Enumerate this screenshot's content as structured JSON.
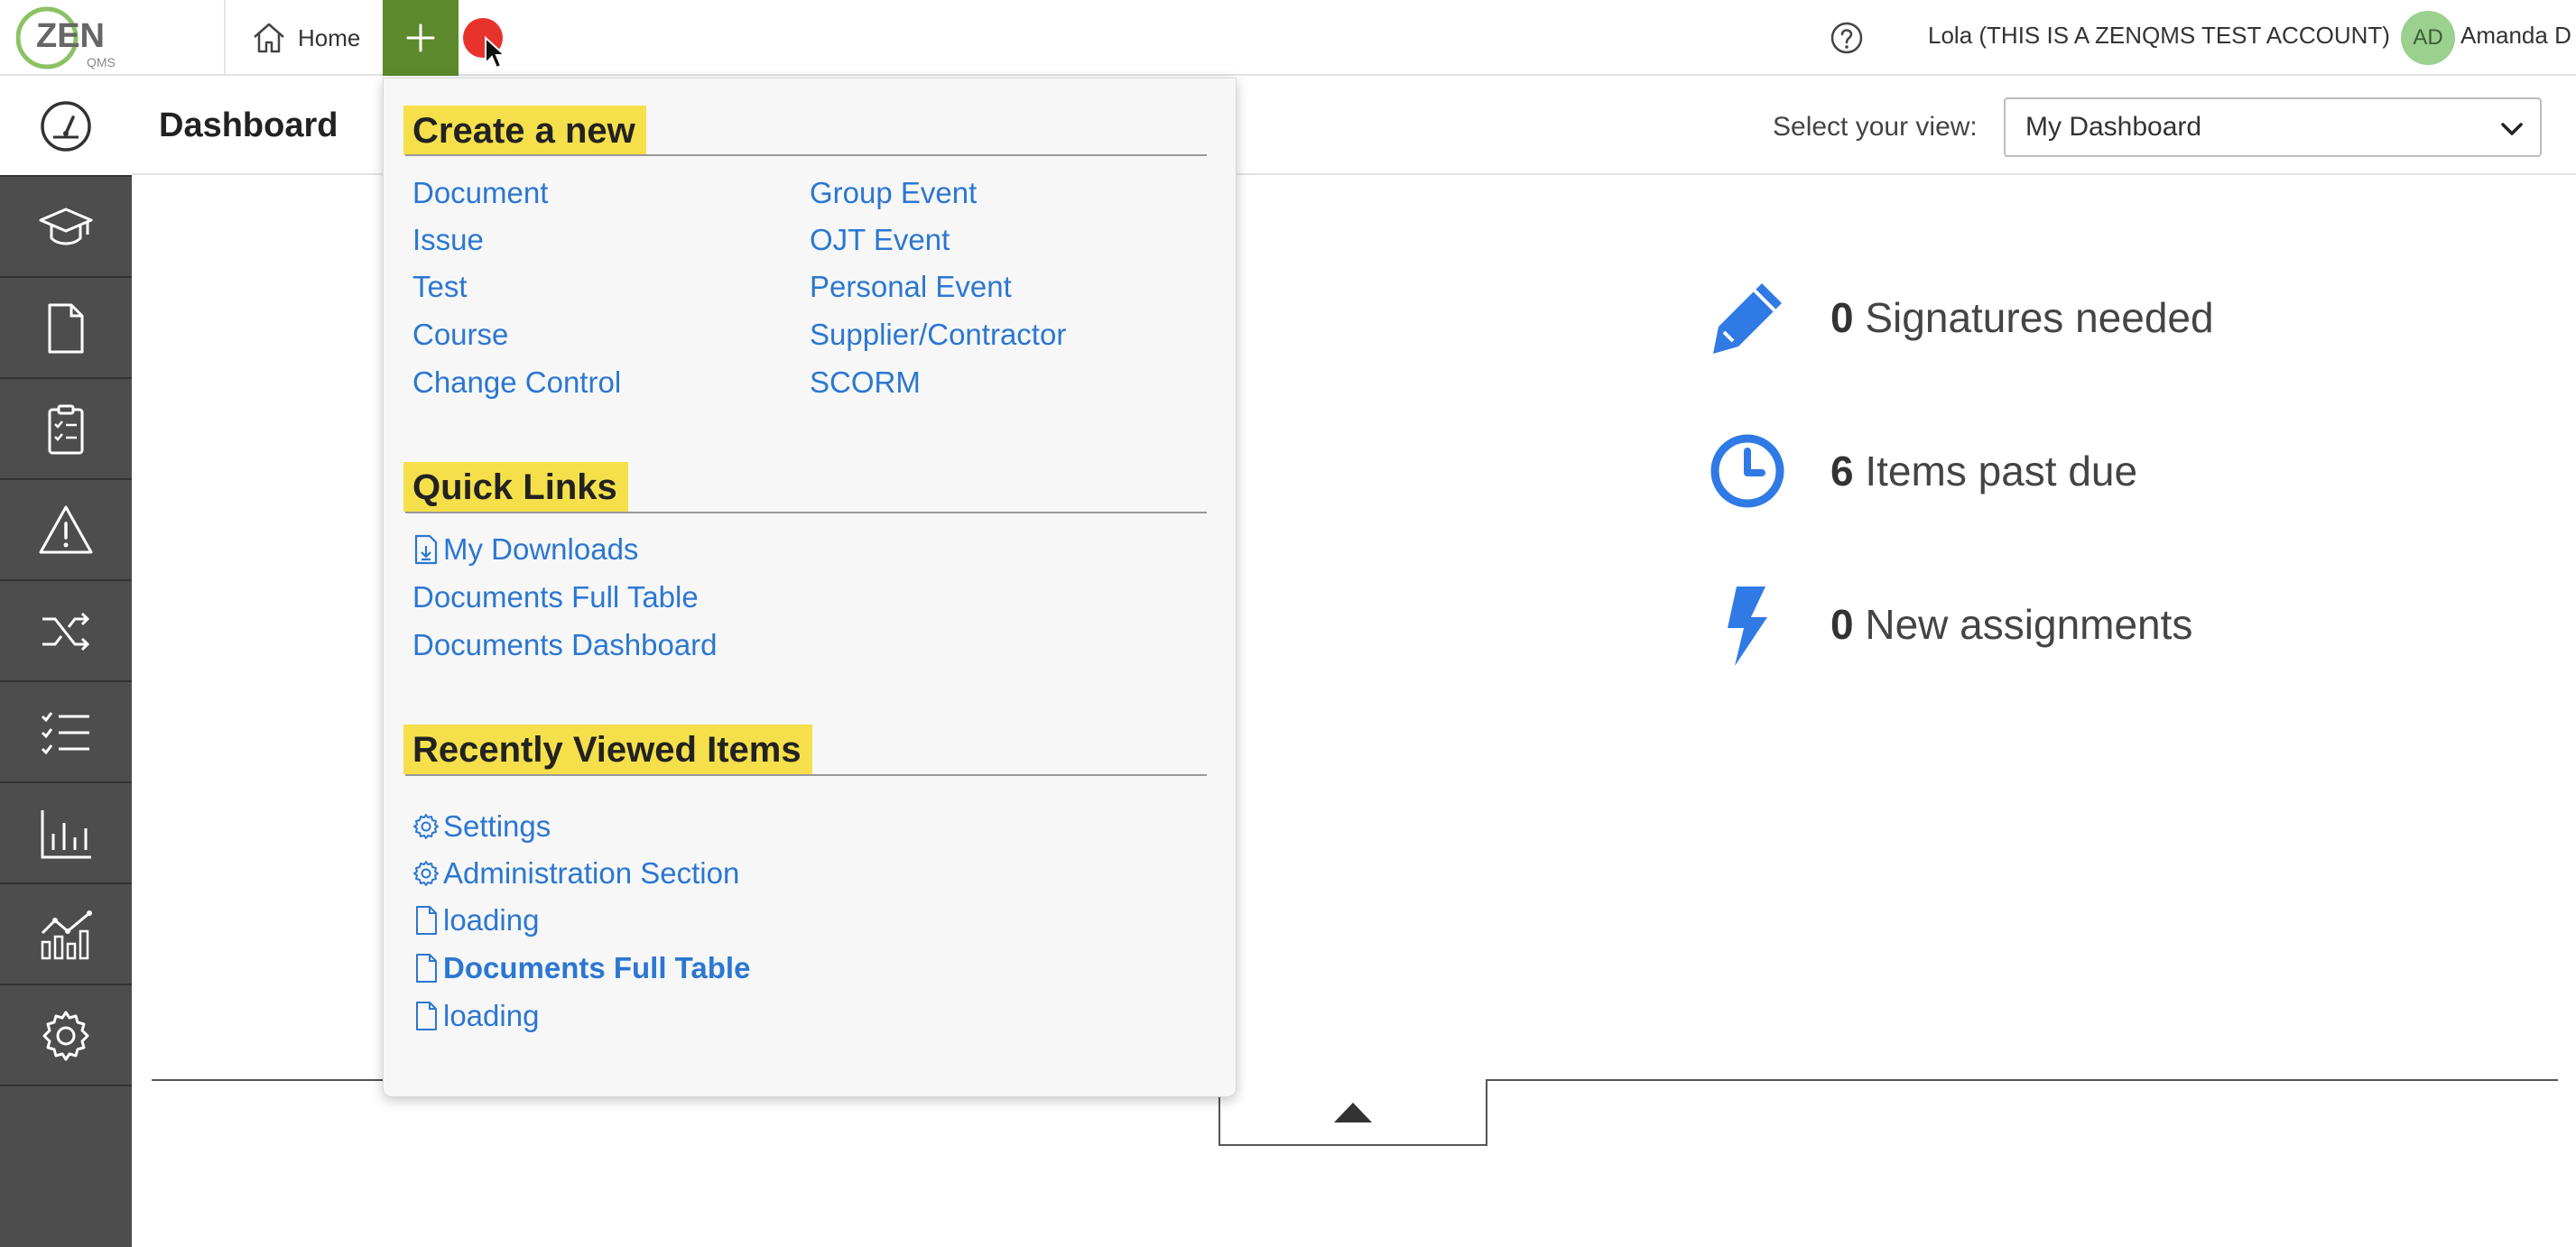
{
  "topbar": {
    "logo_text": "ZEN",
    "logo_sub": "QMS",
    "home_label": "Home",
    "account_name": "Lola (THIS IS A ZENQMS TEST ACCOUNT)",
    "avatar_initials": "AD",
    "user_name": "Amanda D"
  },
  "sidebar": {
    "items": [
      {
        "icon": "dashboard-gauge-icon",
        "active": true
      },
      {
        "icon": "graduation-cap-icon"
      },
      {
        "icon": "document-icon"
      },
      {
        "icon": "clipboard-checklist-icon"
      },
      {
        "icon": "warning-triangle-icon"
      },
      {
        "icon": "shuffle-icon"
      },
      {
        "icon": "checklist-icon"
      },
      {
        "icon": "bar-chart-icon"
      },
      {
        "icon": "trend-chart-icon"
      },
      {
        "icon": "gear-icon"
      }
    ]
  },
  "header": {
    "title": "Dashboard",
    "view_label": "Select your view:",
    "view_selected": "My Dashboard"
  },
  "stats": {
    "signatures": {
      "count": "0",
      "label": "Signatures needed",
      "icon": "pencil-icon"
    },
    "past_due": {
      "count": "6",
      "label": "Items past due",
      "icon": "clock-icon"
    },
    "assignments": {
      "count": "0",
      "label": "New assignments",
      "icon": "lightning-icon"
    }
  },
  "menu": {
    "create_title": "Create a new",
    "create_left": [
      "Document",
      "Issue",
      "Test",
      "Course",
      "Change Control"
    ],
    "create_right": [
      "Group Event",
      "OJT Event",
      "Personal Event",
      "Supplier/Contractor",
      "SCORM"
    ],
    "quick_title": "Quick Links",
    "quick_links": [
      "My Downloads",
      "Documents Full Table",
      "Documents Dashboard"
    ],
    "recent_title": "Recently Viewed Items",
    "recent_items": [
      "Settings",
      "Administration Section",
      "loading",
      "Documents Full Table",
      "loading"
    ]
  },
  "colors": {
    "accent_green": "#5c8a2c",
    "link_blue": "#2b77d2",
    "highlight_yellow": "#f5e04b",
    "sidebar_gray": "#4d4d4d",
    "stat_icon_blue": "#2f7ae5"
  }
}
